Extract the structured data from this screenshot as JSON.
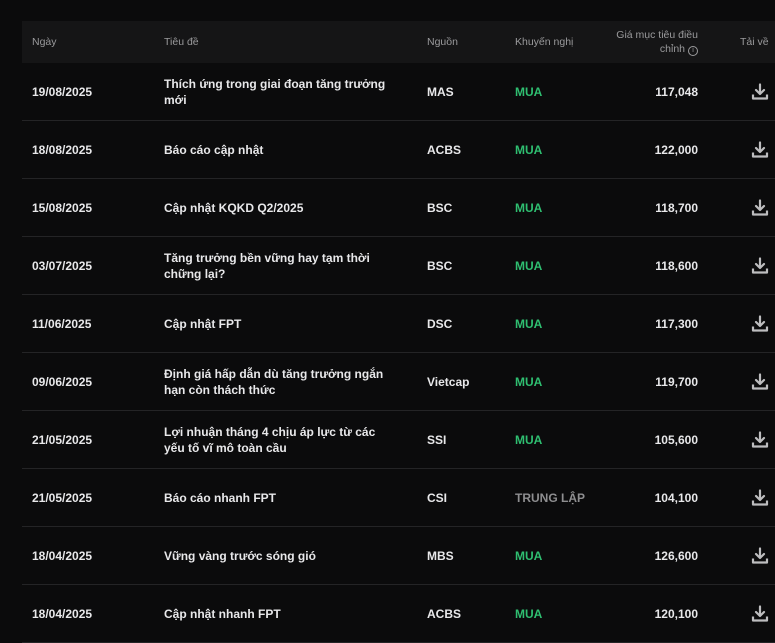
{
  "headers": {
    "date": "Ngày",
    "title": "Tiêu đề",
    "source": "Nguồn",
    "recommendation": "Khuyến nghị",
    "target_price_line1": "Giá mục tiêu điều",
    "target_price_line2": "chỉnh",
    "download": "Tải về"
  },
  "rows": [
    {
      "date": "19/08/2025",
      "title": "Thích ứng trong giai đoạn tăng trưởng mới",
      "source": "MAS",
      "rec": "MUA",
      "rec_type": "buy",
      "price": "117,048"
    },
    {
      "date": "18/08/2025",
      "title": "Báo cáo cập nhật",
      "source": "ACBS",
      "rec": "MUA",
      "rec_type": "buy",
      "price": "122,000"
    },
    {
      "date": "15/08/2025",
      "title": "Cập nhật KQKD Q2/2025",
      "source": "BSC",
      "rec": "MUA",
      "rec_type": "buy",
      "price": "118,700"
    },
    {
      "date": "03/07/2025",
      "title": "Tăng trưởng bền vững hay tạm thời chững lại?",
      "source": "BSC",
      "rec": "MUA",
      "rec_type": "buy",
      "price": "118,600"
    },
    {
      "date": "11/06/2025",
      "title": "Cập nhật FPT",
      "source": "DSC",
      "rec": "MUA",
      "rec_type": "buy",
      "price": "117,300"
    },
    {
      "date": "09/06/2025",
      "title": "Định giá hấp dẫn dù tăng trưởng ngắn hạn còn thách thức",
      "source": "Vietcap",
      "rec": "MUA",
      "rec_type": "buy",
      "price": "119,700"
    },
    {
      "date": "21/05/2025",
      "title": "Lợi nhuận tháng 4 chịu áp lực từ các yếu tố vĩ mô toàn cầu",
      "source": "SSI",
      "rec": "MUA",
      "rec_type": "buy",
      "price": "105,600"
    },
    {
      "date": "21/05/2025",
      "title": "Báo cáo nhanh FPT",
      "source": "CSI",
      "rec": "TRUNG LẬP",
      "rec_type": "neutral",
      "price": "104,100"
    },
    {
      "date": "18/04/2025",
      "title": "Vững vàng trước sóng gió",
      "source": "MBS",
      "rec": "MUA",
      "rec_type": "buy",
      "price": "126,600"
    },
    {
      "date": "18/04/2025",
      "title": "Cập nhật nhanh FPT",
      "source": "ACBS",
      "rec": "MUA",
      "rec_type": "buy",
      "price": "120,100"
    }
  ],
  "icons": {
    "download": "download-icon",
    "info": "info-icon"
  },
  "colors": {
    "buy": "#2fbf71",
    "neutral": "#8e8e90",
    "background": "#0b0b0c",
    "header_bg": "#151516"
  }
}
